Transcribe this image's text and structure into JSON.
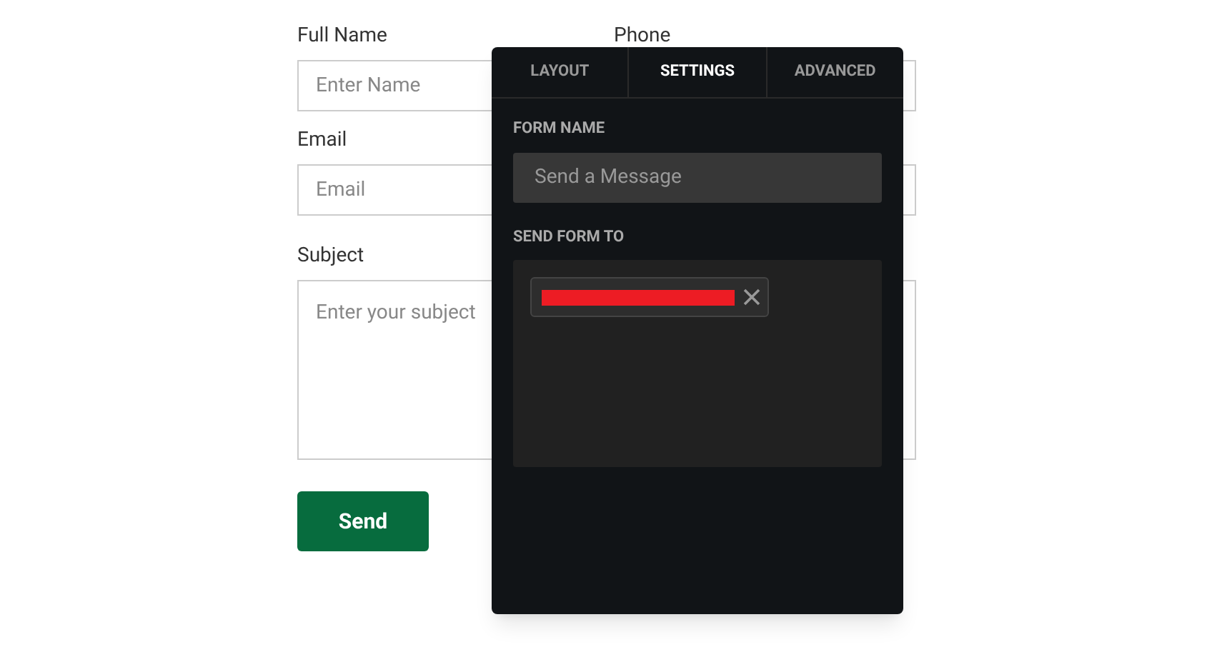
{
  "form": {
    "rows": [
      {
        "fields": [
          {
            "label": "Full Name",
            "placeholder": "Enter Name"
          },
          {
            "label": "Phone"
          }
        ]
      },
      {
        "fields": [
          {
            "label": "Email",
            "placeholder": "Email"
          }
        ]
      }
    ],
    "subject": {
      "label": "Subject",
      "placeholder": "Enter your subject"
    },
    "button": "Send"
  },
  "panel": {
    "tabs": [
      {
        "label": "LAYOUT",
        "selected": false
      },
      {
        "label": "SETTINGS",
        "selected": true
      },
      {
        "label": "ADVANCED",
        "selected": false
      }
    ],
    "form_name": {
      "label": "FORM NAME",
      "value": "Send a Message"
    },
    "send_to": {
      "label": "SEND FORM TO",
      "recipients": [
        {
          "redacted": true
        }
      ]
    }
  }
}
